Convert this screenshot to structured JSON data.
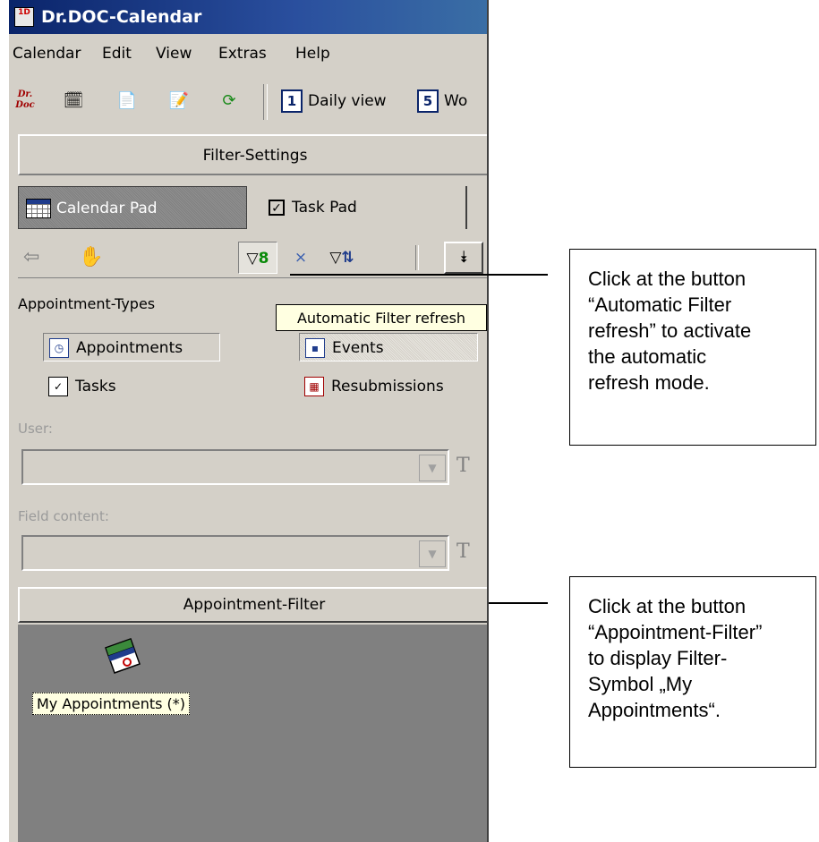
{
  "window": {
    "title": "Dr.DOC-Calendar",
    "app_icon_text": "1D"
  },
  "menu": [
    "Calendar",
    "Edit",
    "View",
    "Extras",
    "Help"
  ],
  "toolbar": {
    "logo_text": "Dr. Doc",
    "daily_view": {
      "num": "1",
      "label": "Daily view"
    },
    "week_view": {
      "num": "5",
      "label": "Wo"
    }
  },
  "filter_settings_label": "Filter-Settings",
  "tabs": {
    "calendar_pad": "Calendar Pad",
    "task_pad": "Task Pad"
  },
  "appointment_types": {
    "heading": "Appointment-Types",
    "appointments": "Appointments",
    "events": "Events",
    "tasks": "Tasks",
    "resubmissions": "Resubmissions"
  },
  "tooltip": "Automatic Filter refresh",
  "user_label": "User:",
  "field_content_label": "Field content:",
  "combo_t": "T",
  "appointment_filter_label": "Appointment-Filter",
  "my_appointments_label": "My Appointments (*)",
  "callouts": {
    "auto_refresh": [
      "Click at the button",
      "“Automatic Filter",
      "refresh” to activate",
      "the automatic",
      "refresh mode."
    ],
    "appt_filter": [
      "Click at the button",
      "“Appointment-Filter”",
      "to display Filter-",
      "Symbol „My",
      "Appointments“."
    ]
  },
  "colors": {
    "titlebar": "#0a246a",
    "window_bg": "#d4d0c8",
    "tooltip_bg": "#ffffe1",
    "panel_bg": "#808080"
  }
}
